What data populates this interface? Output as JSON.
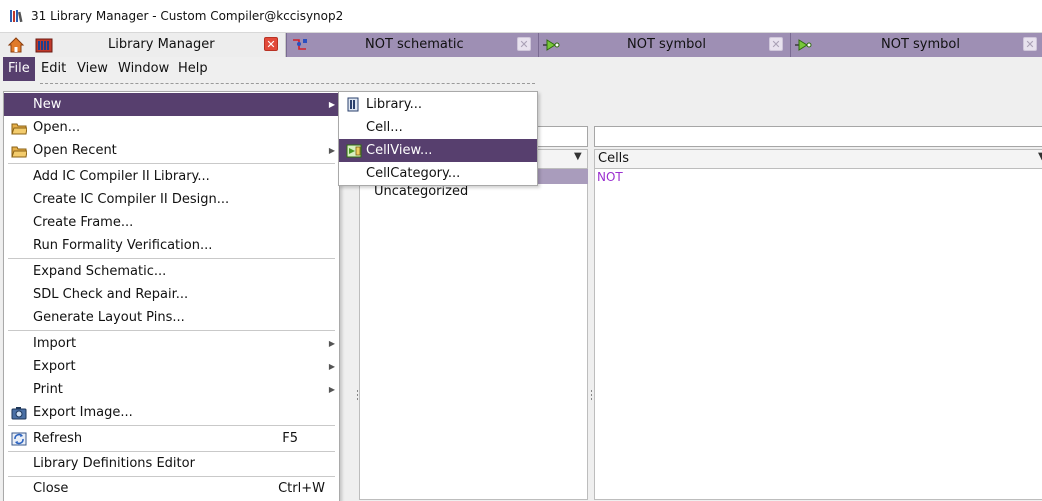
{
  "window": {
    "title": "31 Library Manager - Custom Compiler@kccisynop2"
  },
  "tabs": [
    {
      "label": "Library Manager",
      "icon": "library-manager-icon",
      "active": true
    },
    {
      "label": "NOT schematic",
      "icon": "schematic-icon",
      "active": false
    },
    {
      "label": "NOT symbol",
      "icon": "symbol-icon",
      "active": false
    },
    {
      "label": "NOT symbol",
      "icon": "symbol-icon",
      "active": false
    }
  ],
  "tab_close_glyph": "✕",
  "menubar": [
    "File",
    "Edit",
    "View",
    "Window",
    "Help"
  ],
  "file_menu": {
    "items": [
      {
        "label": "New",
        "submenu": true,
        "highlighted": true
      },
      {
        "label": "Open...",
        "icon": "folder-icon"
      },
      {
        "label": "Open Recent",
        "icon": "folder-icon",
        "submenu": true
      },
      {
        "label": "Add IC Compiler II Library..."
      },
      {
        "label": "Create IC Compiler II Design..."
      },
      {
        "label": "Create Frame..."
      },
      {
        "label": "Run Formality Verification..."
      },
      {
        "label": "Expand Schematic..."
      },
      {
        "label": "SDL Check and Repair..."
      },
      {
        "label": "Generate Layout Pins..."
      },
      {
        "label": "Import",
        "submenu": true
      },
      {
        "label": "Export",
        "submenu": true
      },
      {
        "label": "Print",
        "submenu": true
      },
      {
        "label": "Export Image...",
        "icon": "camera-icon"
      },
      {
        "label": "Refresh",
        "icon": "refresh-icon",
        "shortcut": "F5"
      },
      {
        "label": "Library Definitions Editor"
      },
      {
        "label": "Close",
        "shortcut": "Ctrl+W"
      }
    ]
  },
  "new_submenu": {
    "items": [
      {
        "label": "Library...",
        "icon": "library-icon"
      },
      {
        "label": "Cell..."
      },
      {
        "label": "CellView...",
        "icon": "cellview-icon",
        "highlighted": true
      },
      {
        "label": "CellCategory..."
      }
    ]
  },
  "panels": {
    "categories": {
      "items": [
        "Uncategorized"
      ]
    },
    "cells": {
      "header": "Cells",
      "items": [
        "NOT"
      ]
    }
  },
  "colors": {
    "menu_highlight": "#573f6e",
    "doc_tab": "#9e8fb4",
    "close_active": "#e24a3a",
    "cell_text": "#9b30d0"
  }
}
